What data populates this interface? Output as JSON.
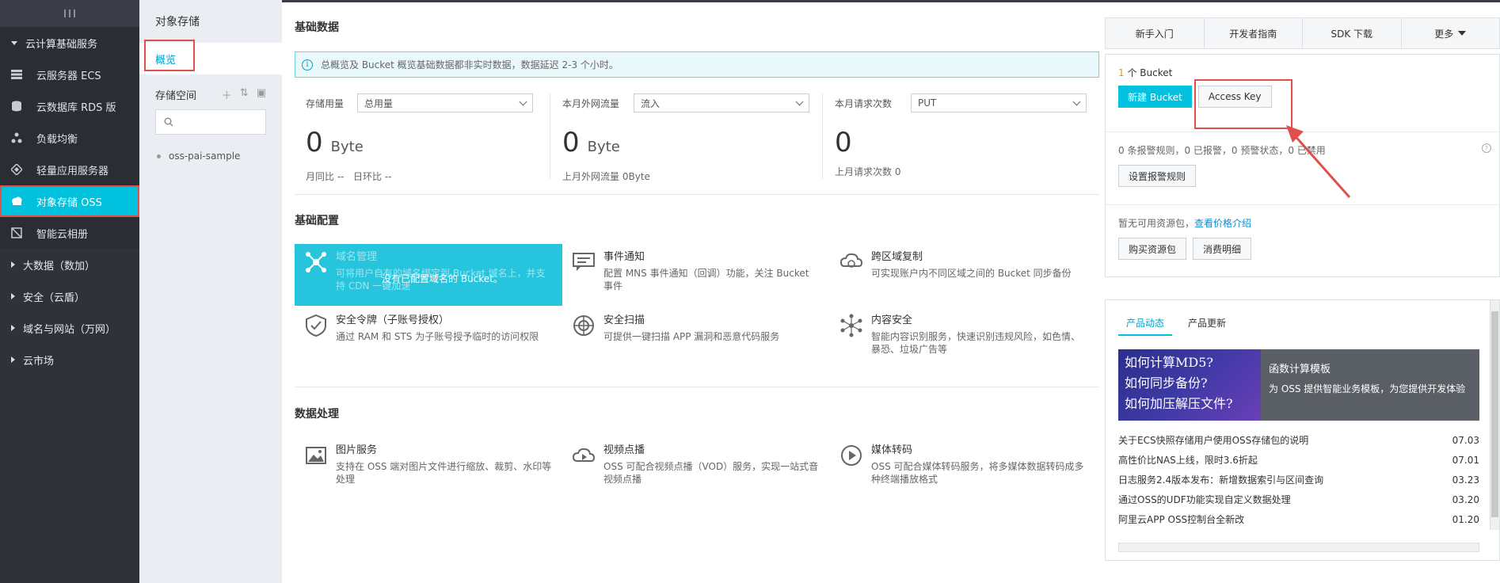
{
  "nav": {
    "groups": {
      "cloud": "云计算基础服务",
      "bigdata": "大数据（数加）",
      "security": "安全（云盾）",
      "domain": "域名与网站（万网）",
      "market": "云市场"
    },
    "items": [
      {
        "label": "云服务器 ECS",
        "icon": "server-icon"
      },
      {
        "label": "云数据库 RDS 版",
        "icon": "database-icon"
      },
      {
        "label": "负载均衡",
        "icon": "load-balancer-icon"
      },
      {
        "label": "轻量应用服务器",
        "icon": "lightweight-server-icon"
      },
      {
        "label": "对象存储 OSS",
        "icon": "oss-cloud-icon"
      },
      {
        "label": "智能云相册",
        "icon": "album-icon"
      }
    ]
  },
  "side": {
    "title": "对象存储",
    "overview": "概览",
    "buckets_title": "存储空间",
    "bucket": "oss-pai-sample"
  },
  "main": {
    "basic_data_title": "基础数据",
    "notice": "总概览及 Bucket 概览基础数据都非实时数据，数据延迟 2-3 个小时。",
    "stats": [
      {
        "label": "存储用量",
        "select": "总用量",
        "value": "0",
        "unit": "Byte",
        "foot1": "月同比",
        "foot1v": "--",
        "foot2": "日环比",
        "foot2v": "--"
      },
      {
        "label": "本月外网流量",
        "select": "流入",
        "value": "0",
        "unit": "Byte",
        "foot": "上月外网流量",
        "footv": "0Byte"
      },
      {
        "label": "本月请求次数",
        "select": "PUT",
        "value": "0",
        "unit": "",
        "foot": "上月请求次数",
        "footv": "0"
      }
    ],
    "config_title": "基础配置",
    "config": [
      {
        "title": "域名管理",
        "desc": "可将用户自有的域名绑定到 Bucket 域名上，并支持 CDN 一键加速",
        "overlay": "没有已配置域名的 Bucket。"
      },
      {
        "title": "事件通知",
        "desc": "配置 MNS 事件通知（回调）功能，关注 Bucket 事件"
      },
      {
        "title": "跨区域复制",
        "desc": "可实现账户内不同区域之间的 Bucket 同步备份"
      },
      {
        "title": "安全令牌（子账号授权）",
        "desc": "通过 RAM 和 STS 为子账号授予临时的访问权限"
      },
      {
        "title": "安全扫描",
        "desc": "可提供一键扫描 APP 漏洞和恶意代码服务"
      },
      {
        "title": "内容安全",
        "desc": "智能内容识别服务，快速识别违规风险，如色情、暴恐、垃圾广告等"
      }
    ],
    "process_title": "数据处理",
    "process": [
      {
        "title": "图片服务",
        "desc": "支持在 OSS 端对图片文件进行缩放、裁剪、水印等处理"
      },
      {
        "title": "视频点播",
        "desc": "OSS 可配合视频点播（VOD）服务，实现一站式音视频点播"
      },
      {
        "title": "媒体转码",
        "desc": "OSS 可配合媒体转码服务，将多媒体数据转码成多种终端播放格式"
      }
    ]
  },
  "right": {
    "top_tabs": [
      "新手入门",
      "开发者指南",
      "SDK 下载",
      "更多"
    ],
    "bucket_count": "1",
    "bucket_count_suffix": "个 Bucket",
    "new_bucket": "新建 Bucket",
    "access_key": "Access Key",
    "alarm_text": "0 条报警规则，0 已报警，0 预警状态，0 已禁用",
    "alarm_button": "设置报警规则",
    "resource_text": "暂无可用资源包，",
    "resource_link": "查看价格介绍",
    "buy_button": "购买资源包",
    "consume_button": "消费明细",
    "news_tabs": [
      "产品动态",
      "产品更新"
    ],
    "banner_lines": [
      "如何计算MD5?",
      "如何同步备份?",
      "如何加压解压文件?"
    ],
    "banner_title": "函数计算模板",
    "banner_desc": "为 OSS 提供智能业务模板，为您提供开发体验",
    "news": [
      {
        "t": "关于ECS快照存储用户使用OSS存储包的说明",
        "d": "07.03"
      },
      {
        "t": "高性价比NAS上线，限时3.6折起",
        "d": "07.01"
      },
      {
        "t": "日志服务2.4版本发布：新增数据索引与区间查询",
        "d": "03.23"
      },
      {
        "t": "通过OSS的UDF功能实现自定义数据处理",
        "d": "03.20"
      },
      {
        "t": "阿里云APP OSS控制台全新改",
        "d": "01.20"
      }
    ]
  },
  "colors": {
    "accent": "#00c1de",
    "nav_bg": "#2f3239",
    "annotation": "#e0504a"
  }
}
